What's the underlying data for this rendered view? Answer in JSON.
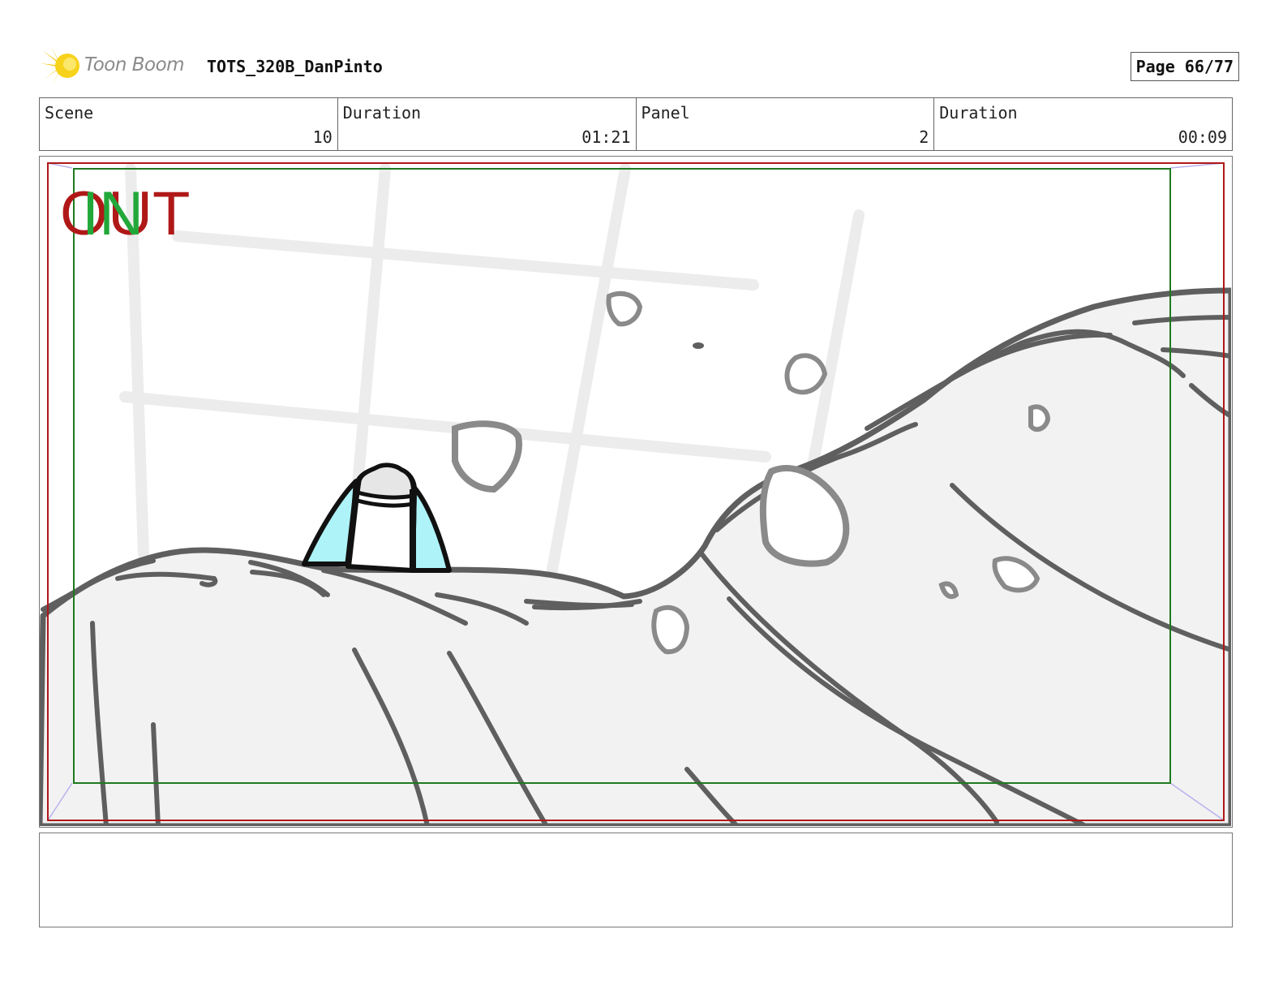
{
  "header": {
    "logo_text": "Toon Boom",
    "project_title": "TOTS_320B_DanPinto",
    "page_label": "Page 66/77"
  },
  "info": [
    {
      "label": "Scene",
      "value": "10"
    },
    {
      "label": "Duration",
      "value": "01:21"
    },
    {
      "label": "Panel",
      "value": "2"
    },
    {
      "label": "Duration",
      "value": "00:09"
    }
  ],
  "panel": {
    "overlay_out": "OUT",
    "overlay_in": "IN",
    "colors": {
      "out_frame": "#b01818",
      "in_frame": "#1e7a1e",
      "sketch_line": "#5f5f5f",
      "fill_light": "#f2f2f2",
      "window_lines": "#ececec",
      "accent_cyan": "#aef3f8"
    }
  },
  "notes": {
    "text": ""
  }
}
